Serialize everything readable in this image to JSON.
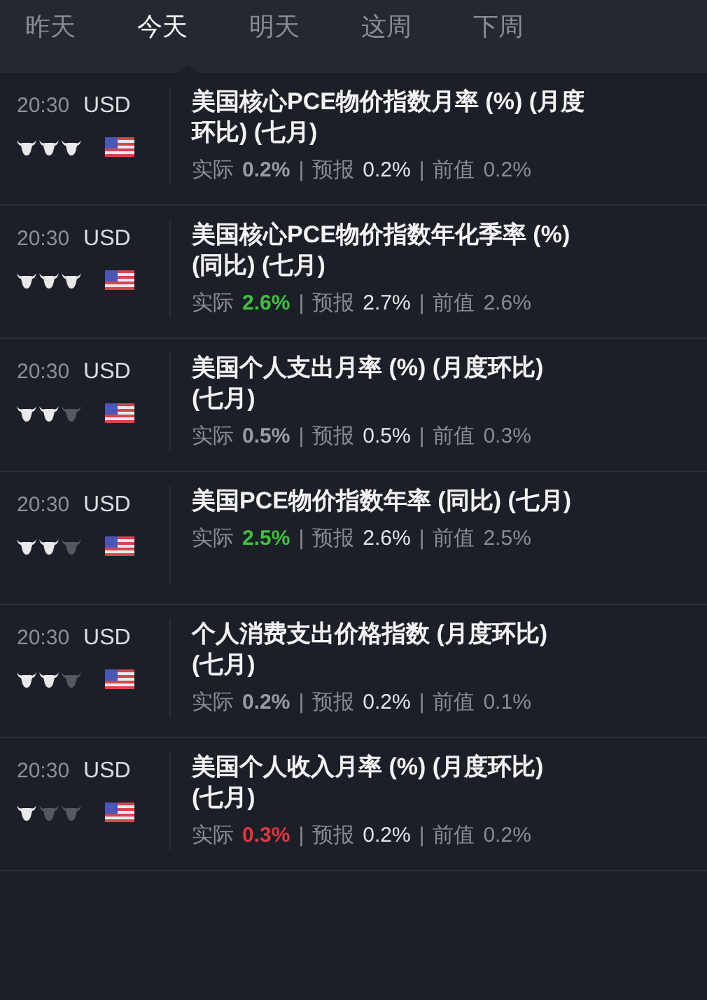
{
  "tabs": [
    {
      "label": "昨天",
      "selected": false
    },
    {
      "label": "今天",
      "selected": true
    },
    {
      "label": "明天",
      "selected": false
    },
    {
      "label": "这周",
      "selected": false
    },
    {
      "label": "下周",
      "selected": false
    }
  ],
  "events": [
    {
      "time": "20:30",
      "currency": "USD",
      "stars": 3,
      "title_lines": [
        "美国核心PCE物价指数月率 (%) (月度",
        "环比) (七月)"
      ],
      "actual": {
        "label": "实际",
        "value": "0.2%",
        "color": "#9a9ca3"
      },
      "forecast": {
        "label": "预报",
        "value": "0.2%"
      },
      "previous": {
        "label": "前值",
        "value": "0.2%"
      },
      "separators": [
        "|",
        "|"
      ]
    },
    {
      "time": "20:30",
      "currency": "USD",
      "stars": 3,
      "title_lines": [
        "美国核心PCE物价指数年化季率 (%)",
        "(同比) (七月)"
      ],
      "actual": {
        "label": "实际",
        "value": "2.6%",
        "color": "#3fc23f"
      },
      "forecast": {
        "label": "预报",
        "value": "2.7%"
      },
      "previous": {
        "label": "前值",
        "value": "2.6%"
      },
      "separators": [
        "|",
        "|"
      ]
    },
    {
      "time": "20:30",
      "currency": "USD",
      "stars": 2,
      "title_lines": [
        "美国个人支出月率 (%) (月度环比)",
        "(七月)"
      ],
      "actual": {
        "label": "实际",
        "value": "0.5%",
        "color": "#9a9ca3"
      },
      "forecast": {
        "label": "预报",
        "value": "0.5%"
      },
      "previous": {
        "label": "前值",
        "value": "0.3%"
      },
      "separators": [
        "|",
        "|"
      ]
    },
    {
      "time": "20:30",
      "currency": "USD",
      "stars": 2,
      "title_lines": [
        "美国PCE物价指数年率 (同比) (七月)"
      ],
      "actual": {
        "label": "实际",
        "value": "2.5%",
        "color": "#3fc23f"
      },
      "forecast": {
        "label": "预报",
        "value": "2.6%"
      },
      "previous": {
        "label": "前值",
        "value": "2.5%"
      },
      "separators": [
        "|",
        "|"
      ]
    },
    {
      "time": "20:30",
      "currency": "USD",
      "stars": 2,
      "title_lines": [
        "个人消费支出价格指数 (月度环比)",
        "(七月)"
      ],
      "actual": {
        "label": "实际",
        "value": "0.2%",
        "color": "#9a9ca3"
      },
      "forecast": {
        "label": "预报",
        "value": "0.2%"
      },
      "previous": {
        "label": "前值",
        "value": "0.1%"
      },
      "separators": [
        "|",
        "|"
      ]
    },
    {
      "time": "20:30",
      "currency": "USD",
      "stars": 1,
      "title_lines": [
        "美国个人收入月率 (%) (月度环比)",
        "(七月)"
      ],
      "actual": {
        "label": "实际",
        "value": "0.3%",
        "color": "#e0383e"
      },
      "forecast": {
        "label": "预报",
        "value": "0.2%"
      },
      "previous": {
        "label": "前值",
        "value": "0.2%"
      },
      "separators": [
        "|",
        "|"
      ]
    }
  ]
}
